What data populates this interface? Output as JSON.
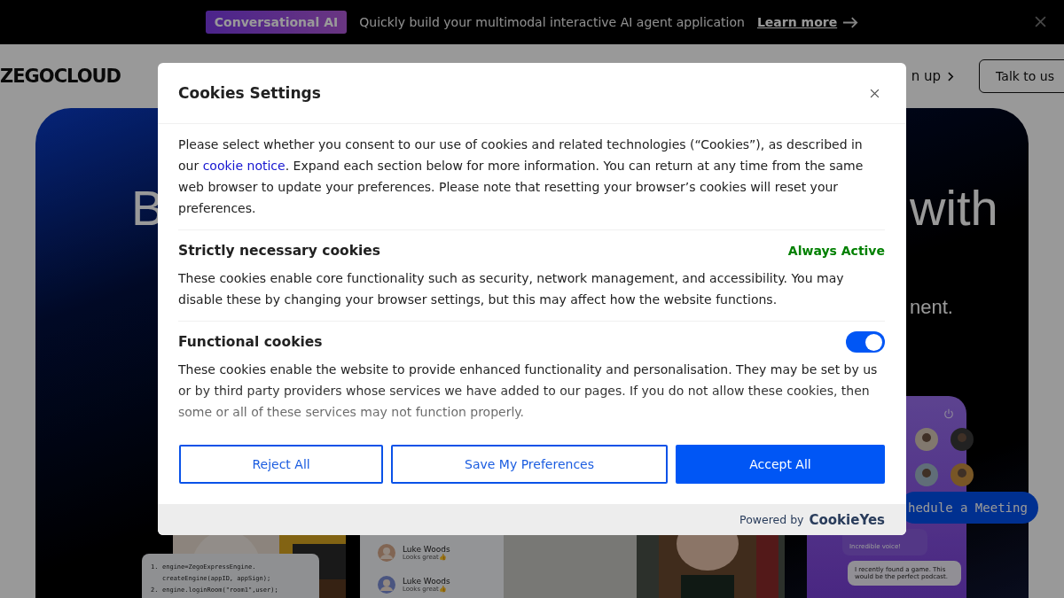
{
  "banner": {
    "badge": "Conversational AI",
    "text": "Quickly build your multimodal interactive AI agent application",
    "link": "Learn more"
  },
  "nav": {
    "logo": "ZEGOCLOUD",
    "link": "n up",
    "button": "Talk to us"
  },
  "hero": {
    "title_left": "B",
    "title_right": "with",
    "subtitle": "nent.",
    "code_lines": [
      {
        "number": "1.",
        "code": "engine=ZegoExpressEngine."
      },
      {
        "code": "createEngine(appID, appSign);"
      },
      {
        "number": "2.",
        "code": "engine.loginRoom(\"room1\",user);"
      }
    ],
    "chat": [
      {
        "name": "Luke Woods",
        "message": "Looks great👍"
      },
      {
        "name": "Luke Woods",
        "message": "Looks great👍"
      }
    ],
    "phone_messages": [
      "Incredible voice!",
      "I recently found a game. This would be the perfect podcast."
    ],
    "meeting_button": "hedule a Meeting"
  },
  "dialog": {
    "title": "Cookies Settings",
    "intro_before": "Please select whether you consent to our use of cookies and related technologies (“Cookies”), as described in our",
    "intro_link": "cookie notice",
    "intro_after": ". Expand each section below for more information. You can return at any time from the same web browser to update your preferences. Please note that resetting your browser’s cookies will reset your preferences.",
    "sections": [
      {
        "kind": "always",
        "title": "Strictly necessary cookies",
        "status": "Always Active",
        "text": "These cookies enable core functionality such as security, network management, and accessibility. You may disable these by changing your browser settings, but this may affect how the website functions."
      },
      {
        "kind": "toggle",
        "title": "Functional cookies",
        "on": true,
        "text": "These cookies enable the website to provide enhanced functionality and personalisation. They may be set by us or by third party providers whose services we have added to our pages. If you do not allow these cookies, then some or all of these services may not function properly."
      }
    ],
    "buttons": [
      {
        "kind": "outline",
        "label": "Reject All"
      },
      {
        "kind": "outline",
        "label": "Save My Preferences"
      },
      {
        "kind": "primary",
        "label": "Accept All"
      }
    ],
    "powered_by": "Powered by",
    "brand": "CookieYes"
  }
}
